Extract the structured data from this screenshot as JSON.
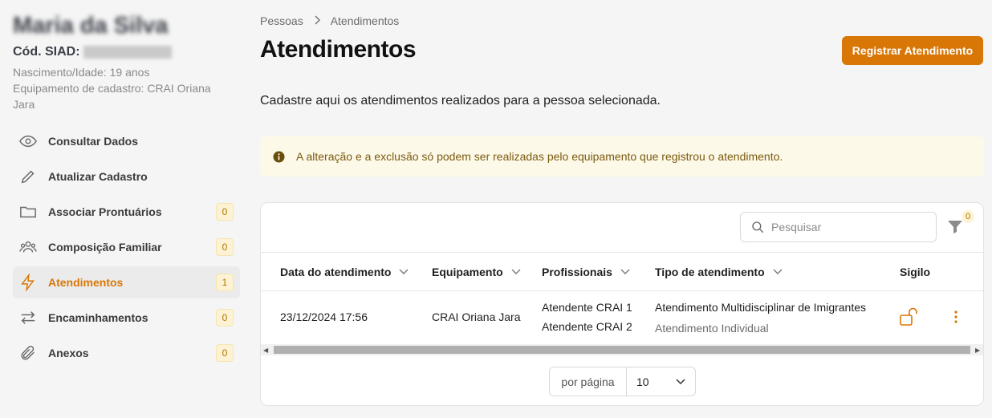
{
  "person": {
    "name": "Maria da Silva",
    "siad_label": "Cód. SIAD:",
    "birth_age": "Nascimento/Idade: 19 anos",
    "equipment": "Equipamento de cadastro: CRAI Oriana Jara"
  },
  "sidebar": {
    "items": [
      {
        "label": "Consultar Dados",
        "icon": "eye-icon",
        "count": null
      },
      {
        "label": "Atualizar Cadastro",
        "icon": "pencil-icon",
        "count": null
      },
      {
        "label": "Associar Prontuários",
        "icon": "folder-icon",
        "count": "0"
      },
      {
        "label": "Composição Familiar",
        "icon": "users-icon",
        "count": "0"
      },
      {
        "label": "Atendimentos",
        "icon": "lightning-icon",
        "count": "1",
        "active": true
      },
      {
        "label": "Encaminhamentos",
        "icon": "arrows-icon",
        "count": "0"
      },
      {
        "label": "Anexos",
        "icon": "paperclip-icon",
        "count": "0"
      }
    ]
  },
  "breadcrumb": {
    "parent": "Pessoas",
    "current": "Atendimentos"
  },
  "page": {
    "title": "Atendimentos",
    "primary_button": "Registrar Atendimento",
    "description": "Cadastre aqui os atendimentos realizados para a pessoa selecionada.",
    "alert": "A alteração e a exclusão só podem ser realizadas pelo equipamento que registrou o atendimento."
  },
  "table": {
    "search_placeholder": "Pesquisar",
    "filter_count": "0",
    "columns": [
      "Data do atendimento",
      "Equipamento",
      "Profissionais",
      "Tipo de atendimento",
      "Sigilo"
    ],
    "rows": [
      {
        "date": "23/12/2024 17:56",
        "equipment": "CRAI Oriana Jara",
        "professional_1": "Atendente CRAI 1",
        "professional_2": "Atendente CRAI 2",
        "type": "Atendimento Multidisciplinar de Imigrantes",
        "subtype": "Atendimento Individual",
        "sigilo": "unlocked"
      }
    ]
  },
  "pagination": {
    "label": "por página",
    "value": "10"
  },
  "colors": {
    "accent": "#d97706",
    "alert_bg": "#fdf9e8",
    "badge_bg": "#fdf3d4"
  }
}
